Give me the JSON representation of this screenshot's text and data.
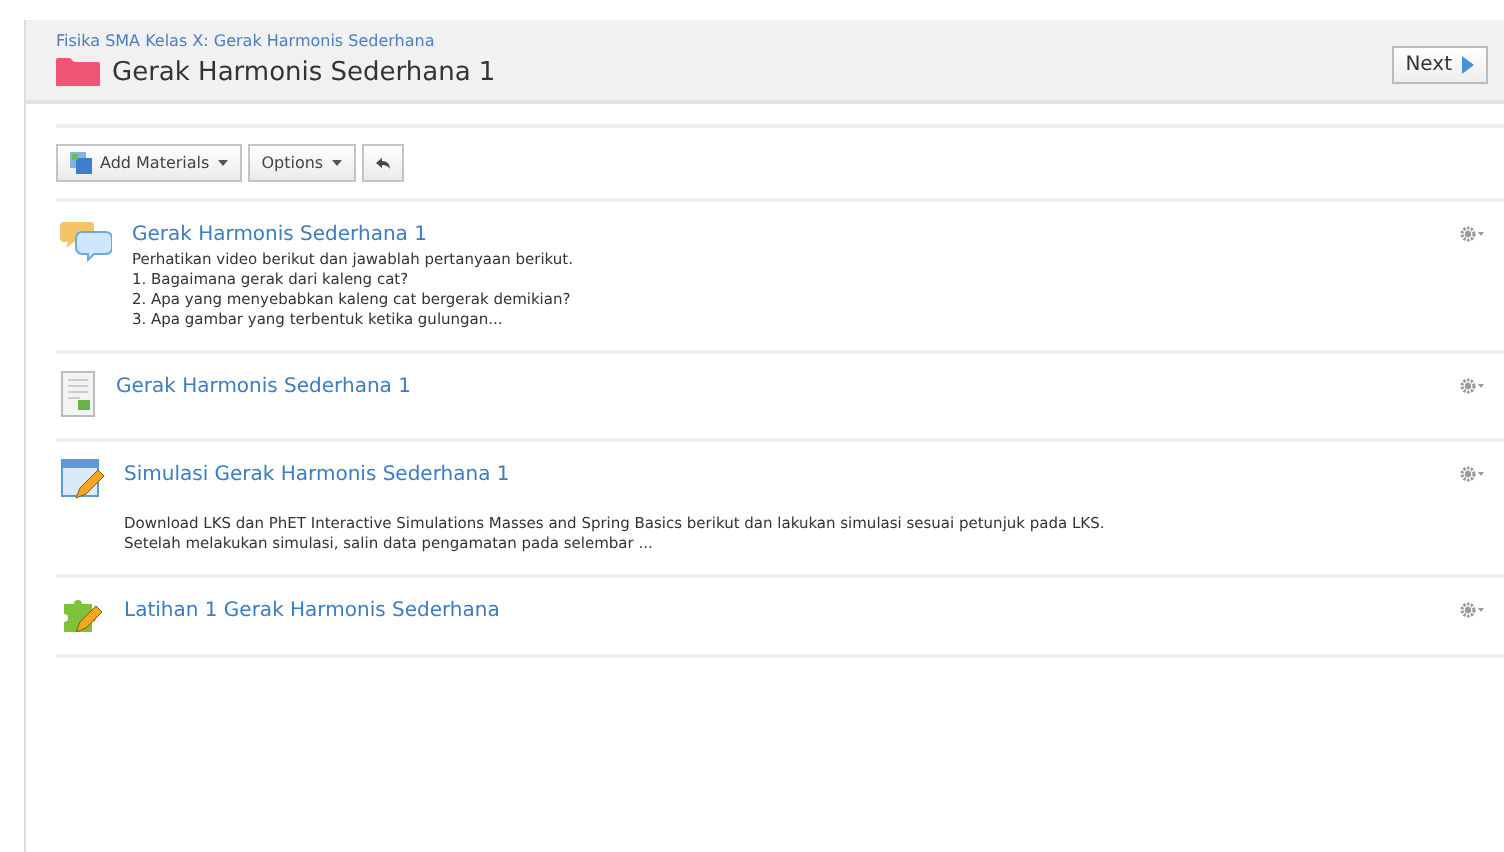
{
  "breadcrumb": "Fisika SMA Kelas X: Gerak Harmonis Sederhana",
  "title": "Gerak Harmonis Sederhana 1",
  "next_button": "Next",
  "toolbar": [
    {
      "kind": "add",
      "label": "Add Materials"
    },
    {
      "kind": "plain",
      "label": "Options"
    },
    {
      "kind": "undo"
    }
  ],
  "items": [
    {
      "kind": "discussion",
      "title": "Gerak Harmonis Sederhana 1",
      "description": [
        "Perhatikan video berikut dan jawablah pertanyaan berikut.",
        "1. Bagaimana gerak dari kaleng cat?",
        "2. Apa yang menyebabkan kaleng cat bergerak demikian?",
        "3. Apa gambar yang terbentuk ketika gulungan..."
      ]
    },
    {
      "kind": "page",
      "title": "Gerak Harmonis Sederhana 1"
    },
    {
      "kind": "assignment",
      "title": "Simulasi Gerak Harmonis Sederhana 1",
      "description": [
        "Download LKS dan PhET Interactive Simulations Masses and Spring Basics berikut dan lakukan simulasi sesuai petunjuk pada LKS.",
        "Setelah melakukan simulasi, salin data pengamatan pada selembar ..."
      ]
    },
    {
      "kind": "assessment",
      "title": "Latihan 1 Gerak Harmonis Sederhana"
    }
  ]
}
